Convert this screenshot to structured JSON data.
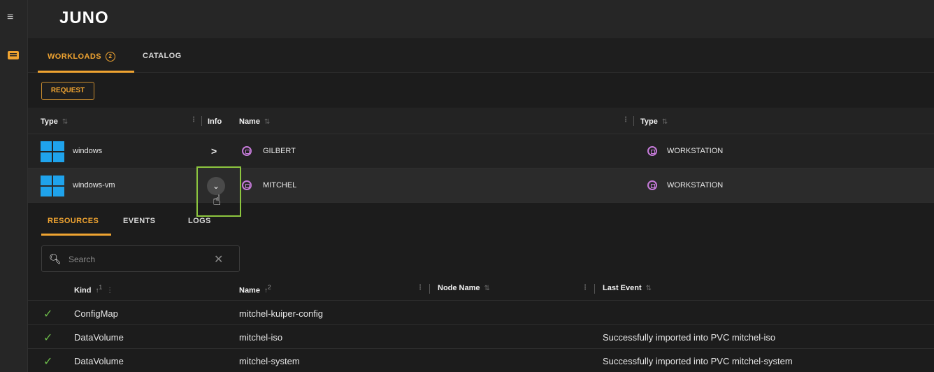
{
  "app": {
    "logo": "JUNO"
  },
  "rail": {
    "menu_icon": "hamburger-icon",
    "messages_icon": "message-icon"
  },
  "tabs": [
    {
      "label": "WORKLOADS",
      "badge": "2"
    },
    {
      "label": "CATALOG"
    }
  ],
  "request_label": "REQUEST",
  "grid": {
    "headers": [
      "Type",
      "Info",
      "Name",
      "Type"
    ],
    "rows": [
      {
        "os": "windows",
        "name": "GILBERT",
        "type": "WORKSTATION",
        "info": ">"
      },
      {
        "os": "windows-vm",
        "name": "MITCHEL",
        "type": "WORKSTATION",
        "info": "⌄"
      }
    ]
  },
  "subtabs": [
    "RESOURCES",
    "EVENTS",
    "LOGS"
  ],
  "search": {
    "placeholder": "Search"
  },
  "resources": {
    "headers": [
      "Kind",
      "Name",
      "Node Name",
      "Last Event"
    ],
    "kind_sort": "1",
    "name_sort": "2",
    "rows": [
      {
        "kind": "ConfigMap",
        "name": "mitchel-kuiper-config",
        "node": "",
        "event": ""
      },
      {
        "kind": "DataVolume",
        "name": "mitchel-iso",
        "node": "",
        "event": "Successfully imported into PVC mitchel-iso"
      },
      {
        "kind": "DataVolume",
        "name": "mitchel-system",
        "node": "",
        "event": "Successfully imported into PVC mitchel-system"
      }
    ]
  },
  "colors": {
    "accent": "#f0a431",
    "highlight": "#8dc63f",
    "windows": "#1fa3ec",
    "chip": "#c47ad8",
    "ok": "#6dbb4a"
  }
}
